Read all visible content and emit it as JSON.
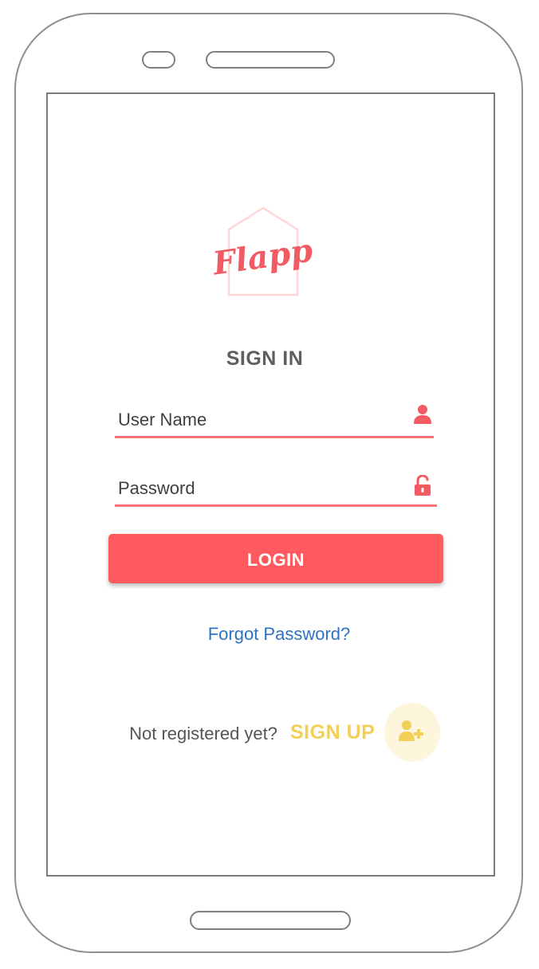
{
  "app": {
    "logo_text": "Flapp"
  },
  "signin": {
    "title": "SIGN IN",
    "username_placeholder": "User Name",
    "password_placeholder": "Password",
    "login_label": "LOGIN",
    "forgot_label": "Forgot Password?"
  },
  "signup": {
    "prompt": "Not registered yet?",
    "link_label": "SIGN UP",
    "icon": "add-user-icon"
  },
  "icons": {
    "username": "user-icon",
    "password": "unlock-icon"
  },
  "colors": {
    "accent": "#ff5a5f",
    "link": "#2e73c3",
    "signup": "#f2cf56",
    "signup_bg": "#fdf5dc"
  }
}
